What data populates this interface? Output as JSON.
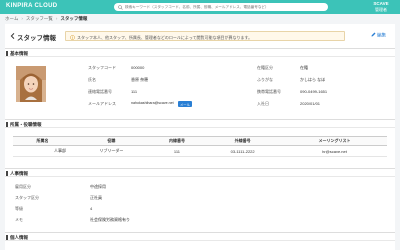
{
  "app": {
    "logo": "KINPIRA CLOUD"
  },
  "search": {
    "placeholder": "検索キーワード（スタッフコード、名前、所属、役職、メールアドレス、電話番号など）"
  },
  "user": {
    "name": "SCAVE",
    "role": "管理者"
  },
  "breadcrumb": [
    "ホーム",
    "スタッフ一覧",
    "スタッフ情報"
  ],
  "header": {
    "title": "スタッフ情報",
    "notice": "スタッフ本人、他スタッフ、所属長、管理者などのロールによって閲覧可能な項目が異なります。",
    "edit_label": "編集"
  },
  "sections": {
    "basic": "基本情報",
    "dept": "所属・役職情報",
    "hr": "人事情報",
    "personal": "個人情報"
  },
  "basic": {
    "labels": {
      "code": "スタッフコード",
      "name": "氏名",
      "phone": "連絡電話番号",
      "email": "メールアドレス",
      "status": "在籍区分",
      "kana": "ふりがな",
      "mobile": "携帯電話番号",
      "joined": "入社日"
    },
    "values": {
      "code": "000000",
      "name": "香原 奈穂",
      "phone": "111",
      "email": "nahokashihara@scave.net",
      "email_badge": "メール",
      "status": "在籍",
      "kana": "かしはら なほ",
      "mobile": "090-0499-1651",
      "joined": "2020/01/01"
    }
  },
  "dept_table": {
    "headers": [
      "所属名",
      "役職",
      "内線番号",
      "外線番号",
      "メーリングリスト"
    ],
    "rows": [
      [
        "人事部",
        "リブリーダー",
        "111",
        "03-1111-2222",
        "hr@scave.net"
      ]
    ]
  },
  "hr": [
    {
      "label": "雇用区分",
      "value": "中途採用"
    },
    {
      "label": "スタッフ区分",
      "value": "正社員"
    },
    {
      "label": "等級",
      "value": "4"
    },
    {
      "label": "メモ",
      "value": "社会保険労務資格有り"
    }
  ],
  "colors": {
    "topbar": "#3cc3b8",
    "accent": "#2a7fd4",
    "notice_bg": "#fff8ea"
  }
}
